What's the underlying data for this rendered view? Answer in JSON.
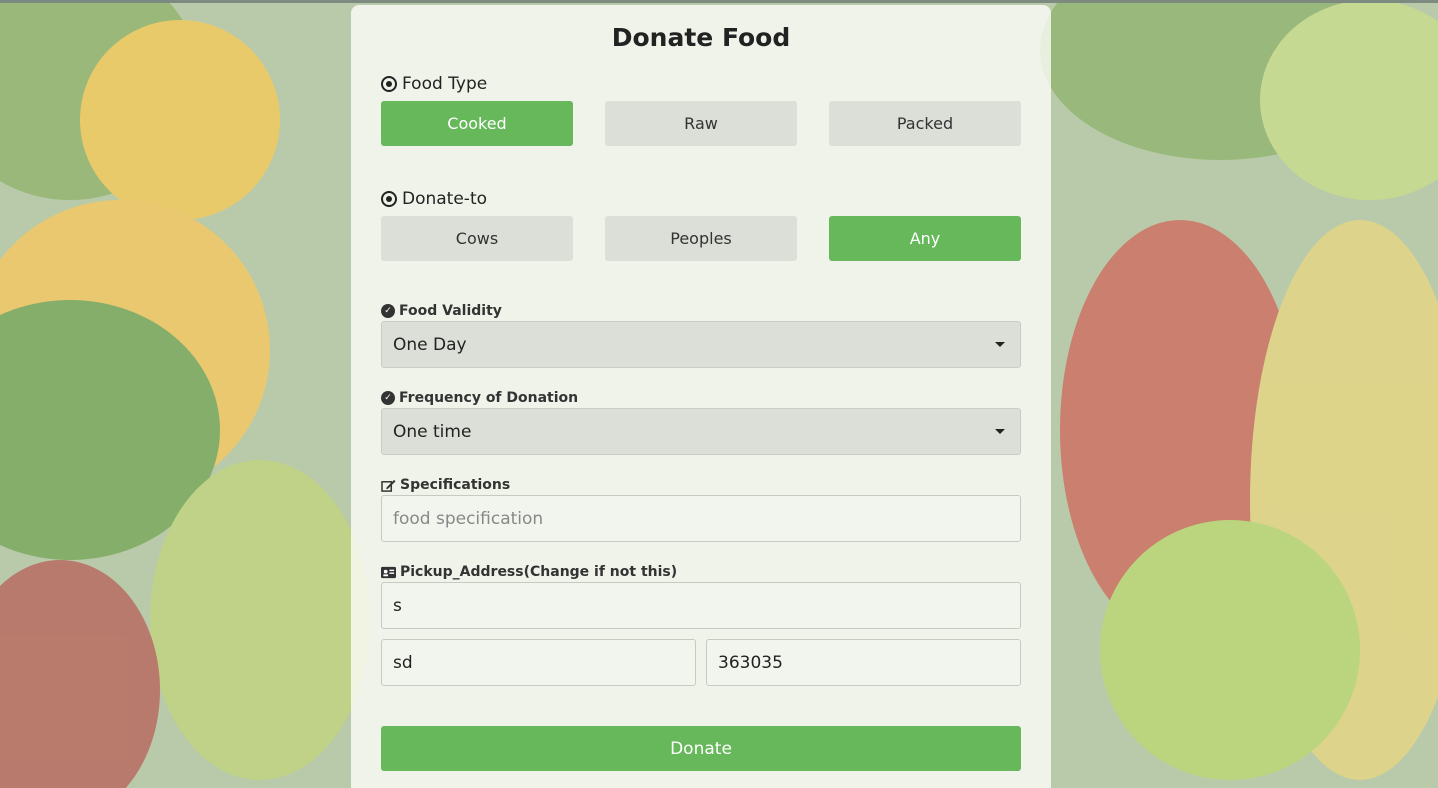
{
  "page_title": "Donate Food",
  "food_type": {
    "label": "Food Type",
    "options": [
      "Cooked",
      "Raw",
      "Packed"
    ],
    "selected": "Cooked"
  },
  "donate_to": {
    "label": "Donate-to",
    "options": [
      "Cows",
      "Peoples",
      "Any"
    ],
    "selected": "Any"
  },
  "food_validity": {
    "label": "Food Validity",
    "value": "One Day"
  },
  "frequency": {
    "label": "Frequency of Donation",
    "value": "One time"
  },
  "specifications": {
    "label": "Specifications",
    "placeholder": "food specification"
  },
  "pickup_address": {
    "label": "Pickup_Address(Change if not this)",
    "line1": "s",
    "city": "sd",
    "pincode": "363035"
  },
  "submit_label": "Donate",
  "colors": {
    "accent": "#66b85b",
    "neutral_button": "#d7dbd4"
  },
  "icons": [
    "radio-icon",
    "check-circle-icon",
    "edit-icon",
    "address-card-icon",
    "caret-down-icon"
  ]
}
